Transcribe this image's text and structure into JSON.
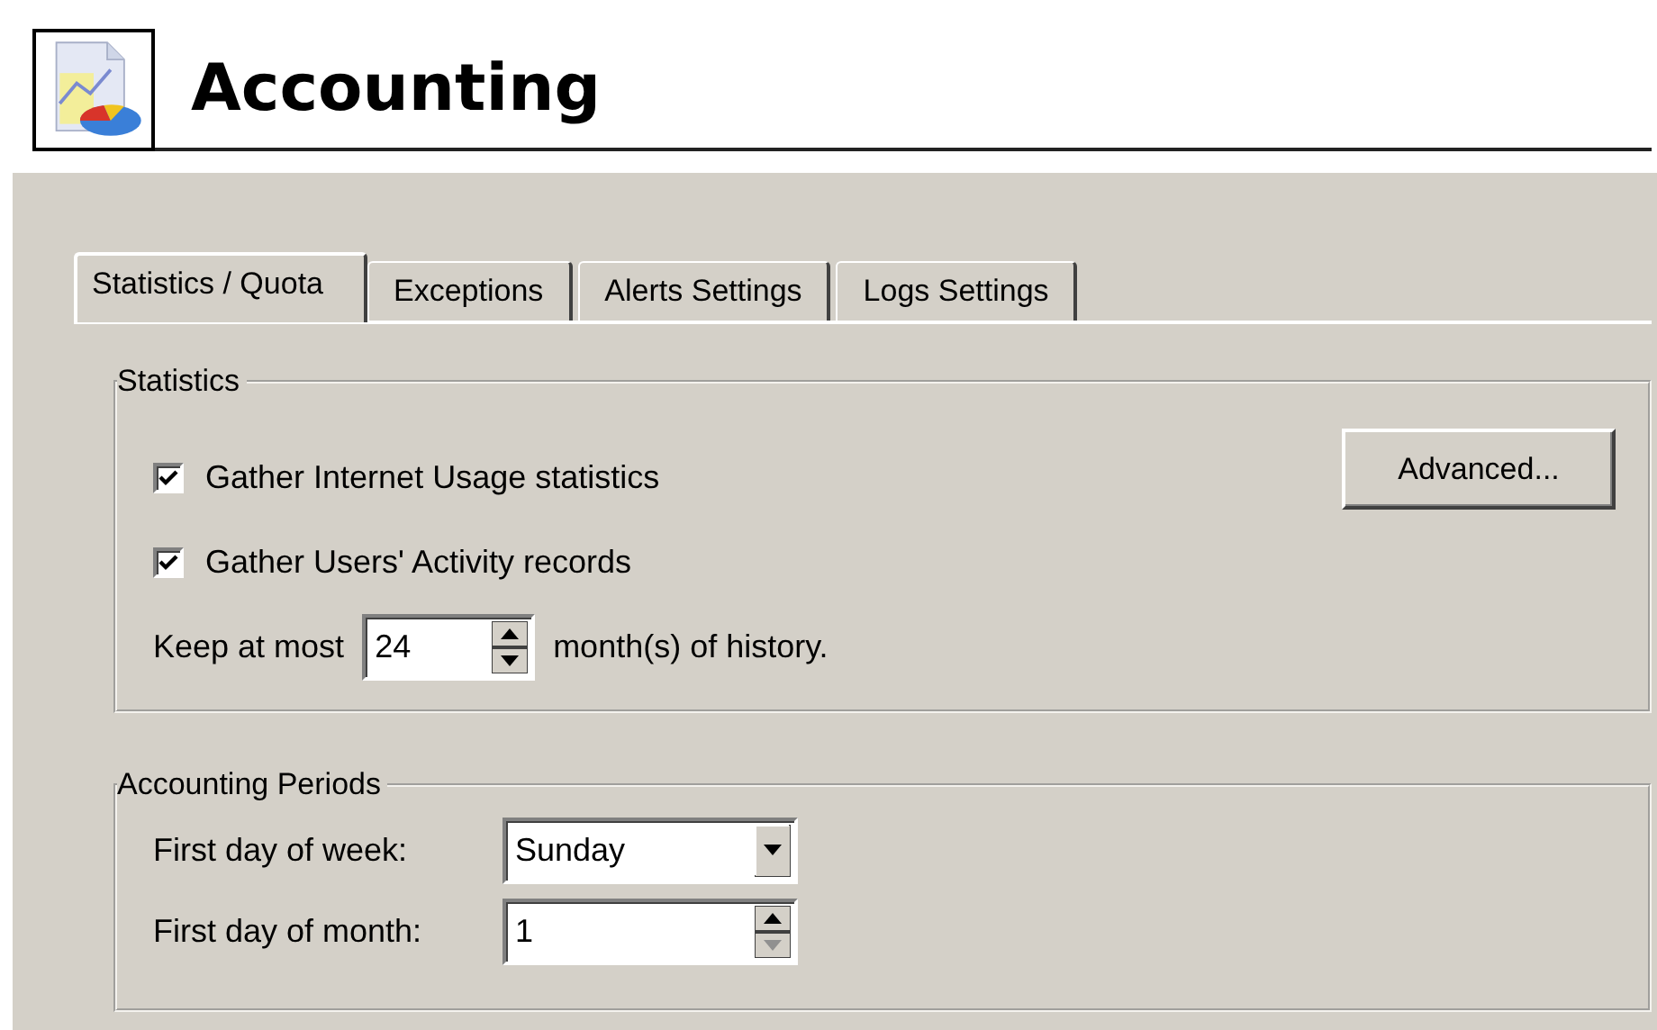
{
  "header": {
    "title": "Accounting"
  },
  "tabs": [
    {
      "label": "Statistics / Quota",
      "selected": true
    },
    {
      "label": "Exceptions",
      "selected": false
    },
    {
      "label": "Alerts Settings",
      "selected": false
    },
    {
      "label": "Logs Settings",
      "selected": false
    }
  ],
  "statistics": {
    "legend": "Statistics",
    "checkboxes": [
      {
        "label": "Gather Internet Usage statistics",
        "checked": true
      },
      {
        "label": "Gather Users' Activity records",
        "checked": true
      }
    ],
    "advanced_button": "Advanced...",
    "history": {
      "prefix": "Keep at most",
      "value": "24",
      "suffix": "month(s) of history."
    }
  },
  "periods": {
    "legend": "Accounting Periods",
    "first_day_of_week": {
      "label": "First day of week:",
      "value": "Sunday"
    },
    "first_day_of_month": {
      "label": "First day of month:",
      "value": "1"
    }
  }
}
